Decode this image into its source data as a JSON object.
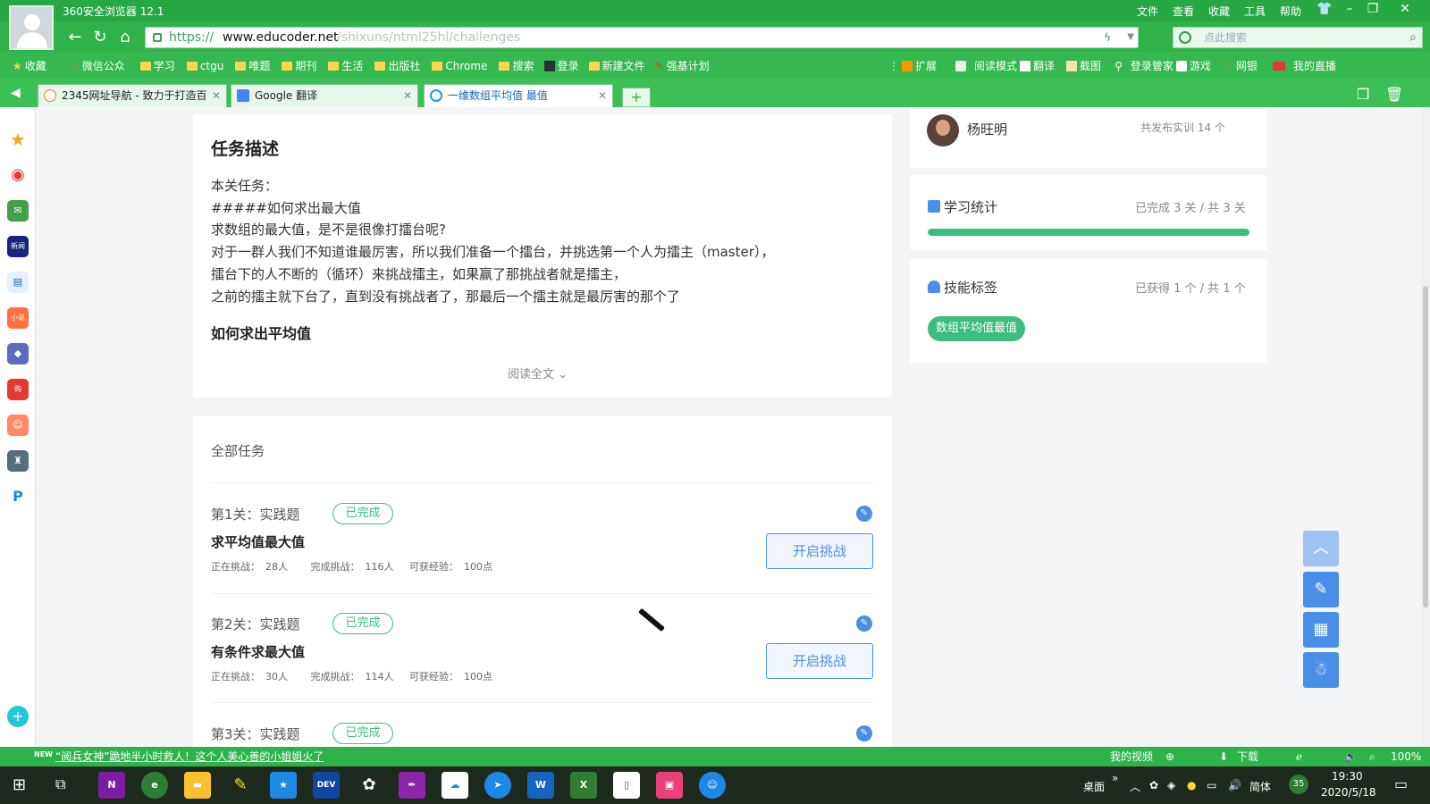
{
  "browser": {
    "title": "360安全浏览器 12.1",
    "menu": [
      "文件",
      "查看",
      "收藏",
      "工具",
      "帮助"
    ],
    "url_protocol": "https://",
    "url_host": "www.educoder.net",
    "url_path": "/shixuns/ntml25hl/challenges",
    "search_placeholder": "点此搜索",
    "bookmarks": [
      "收藏",
      "微信公众",
      "学习",
      "ctgu",
      "唯题",
      "期刊",
      "生活",
      "出版社",
      "Chrome",
      "搜索",
      "登录",
      "新建文件",
      "强基计划"
    ],
    "bookmarks_right": [
      "扩展",
      "阅读模式",
      "翻译",
      "截图",
      "登录管家",
      "游戏",
      "网银",
      "我的直播"
    ],
    "tabs": [
      {
        "label": "2345网址导航 - 致力于打造百"
      },
      {
        "label": "Google 翻译"
      },
      {
        "label": "一维数组平均值 最值"
      }
    ],
    "new_tab": "+"
  },
  "description": {
    "title": "任务描述",
    "lines": [
      "本关任务：",
      "#####如何求出最大值",
      "求数组的最大值，是不是很像打擂台呢?",
      "对于一群人我们不知道谁最厉害，所以我们准备一个擂台，并挑选第一个人为擂主（master），",
      "擂台下的人不断的（循环）来挑战擂主，如果赢了那挑战者就是擂主，",
      "之前的擂主就下台了，直到没有挑战者了，那最后一个擂主就是最厉害的那个了"
    ],
    "subtitle": "如何求出平均值",
    "read_more": "阅读全文"
  },
  "tasks": {
    "header": "全部任务",
    "items": [
      {
        "stage": "第1关：实践题",
        "status": "已完成",
        "name": "求平均值最大值",
        "challenging_label": "正在挑战：",
        "challenging": "28人",
        "completed_label": "完成挑战：",
        "completed": "116人",
        "exp_label": "可获经验：",
        "exp": "100点",
        "button": "开启挑战"
      },
      {
        "stage": "第2关：实践题",
        "status": "已完成",
        "name": "有条件求最大值",
        "challenging_label": "正在挑战：",
        "challenging": "30人",
        "completed_label": "完成挑战：",
        "completed": "114人",
        "exp_label": "可获经验：",
        "exp": "100点",
        "button": "开启挑战"
      },
      {
        "stage": "第3关：实践题",
        "status": "已完成"
      }
    ]
  },
  "author": {
    "name": "杨旺明",
    "count": "共发布实训 14 个"
  },
  "stats": {
    "title": "学习统计",
    "summary": "已完成 3 关 / 共 3 关",
    "progress": 1.0
  },
  "skills": {
    "title": "技能标签",
    "summary": "已获得 1 个 / 共 1 个",
    "tag": "数组平均值最值"
  },
  "statusbar": {
    "news_tag": "NEW",
    "news": "“阅兵女神”跪地半小时救人！这个人美心善的小姐姐火了",
    "my_video": "我的视频",
    "download": "下载",
    "zoom": "100%"
  },
  "taskbar": {
    "desktop": "桌面",
    "ime": "简体",
    "badge": "35",
    "time": "19:30",
    "date": "2020/5/18"
  },
  "colors": {
    "accent": "#3dbd7d",
    "primary": "#4a8fe7",
    "browser": "#2fb24a"
  }
}
